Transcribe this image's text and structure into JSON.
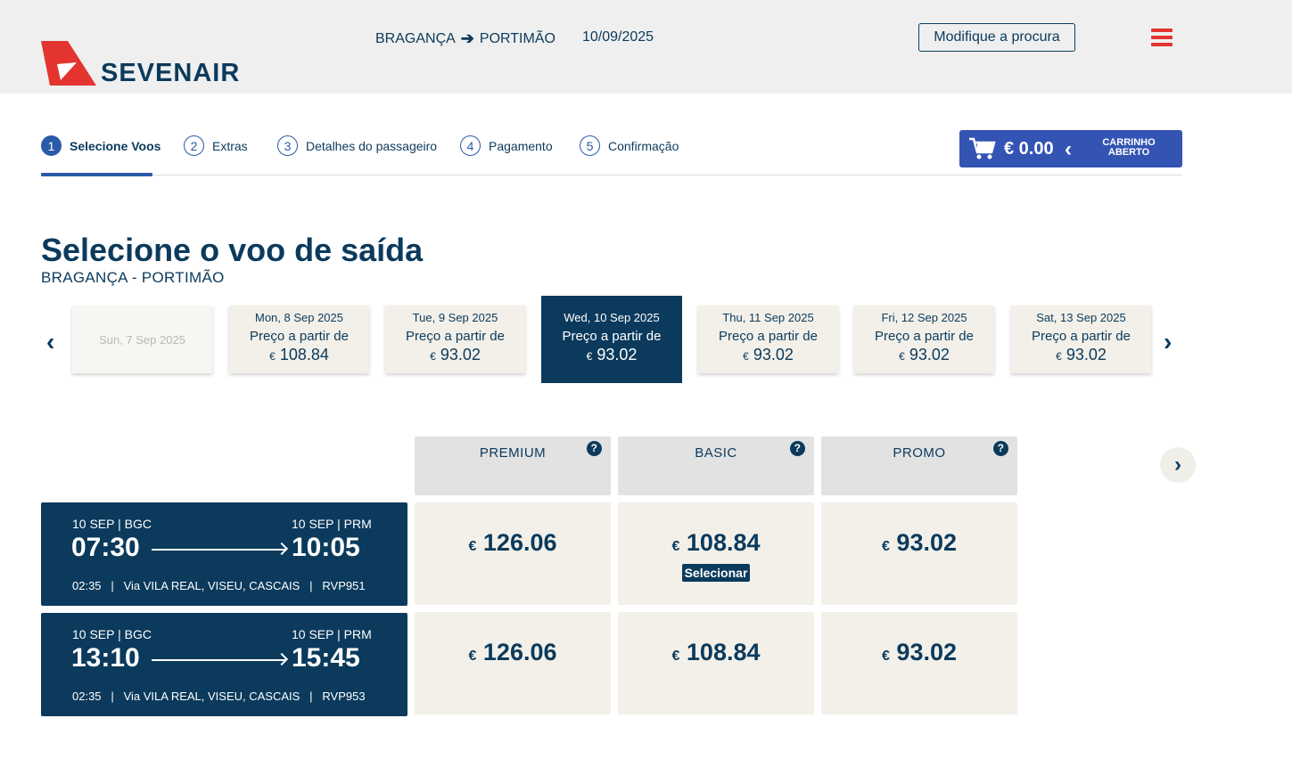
{
  "header": {
    "brand": "SEVENAIR",
    "origin": "BRAGANÇA",
    "arrow": "➔",
    "destination": "PORTIMÃO",
    "date": "10/09/2025",
    "modify_label": "Modifique a procura"
  },
  "steps": [
    {
      "num": "1",
      "label": "Selecione Voos",
      "active": true
    },
    {
      "num": "2",
      "label": "Extras"
    },
    {
      "num": "3",
      "label": "Detalhes do passageiro"
    },
    {
      "num": "4",
      "label": "Pagamento"
    },
    {
      "num": "5",
      "label": "Confirmação"
    }
  ],
  "cart": {
    "amount": "€ 0.00",
    "chevron": "‹",
    "label": "CARRINHO ABERTO"
  },
  "page": {
    "title": "Selecione o voo de saída",
    "subtitle": "BRAGANÇA - PORTIMÃO"
  },
  "dates": [
    {
      "date": "Sun, 7 Sep 2025",
      "disabled": true
    },
    {
      "date": "Mon, 8 Sep 2025",
      "from": "Preço a partir de",
      "cur": "€",
      "price": "108.84"
    },
    {
      "date": "Tue, 9 Sep 2025",
      "from": "Preço a partir de",
      "cur": "€",
      "price": "93.02"
    },
    {
      "date": "Wed, 10 Sep 2025",
      "from": "Preço a partir de",
      "cur": "€",
      "price": "93.02",
      "selected": true
    },
    {
      "date": "Thu, 11 Sep 2025",
      "from": "Preço a partir de",
      "cur": "€",
      "price": "93.02"
    },
    {
      "date": "Fri, 12 Sep 2025",
      "from": "Preço a partir de",
      "cur": "€",
      "price": "93.02"
    },
    {
      "date": "Sat, 13 Sep 2025",
      "from": "Preço a partir de",
      "cur": "€",
      "price": "93.02"
    }
  ],
  "carousel": {
    "prev": "‹",
    "next": "›"
  },
  "fares": [
    {
      "name": "PREMIUM",
      "help": "?"
    },
    {
      "name": "BASIC",
      "help": "?"
    },
    {
      "name": "PROMO",
      "help": "?"
    }
  ],
  "fares_next": "›",
  "flights": [
    {
      "dep_date": "10 SEP | BGC",
      "arr_date": "10 SEP | PRM",
      "dep_time": "07:30",
      "arr_time": "10:05",
      "info": "02:35   |   Via VILA REAL, VISEU, CASCAIS   |   RVP951",
      "prices": [
        {
          "cur": "€",
          "value": "126.06"
        },
        {
          "cur": "€",
          "value": "108.84",
          "select": "Selecionar"
        },
        {
          "cur": "€",
          "value": "93.02"
        }
      ]
    },
    {
      "dep_date": "10 SEP | BGC",
      "arr_date": "10 SEP | PRM",
      "dep_time": "13:10",
      "arr_time": "15:45",
      "info": "02:35   |   Via VILA REAL, VISEU, CASCAIS   |   RVP953",
      "prices": [
        {
          "cur": "€",
          "value": "126.06"
        },
        {
          "cur": "€",
          "value": "108.84"
        },
        {
          "cur": "€",
          "value": "93.02"
        }
      ]
    }
  ],
  "colors": {
    "navy": "#0b3a5c",
    "blue": "#2b5aa8",
    "cart": "#3454b4",
    "red": "#e3342f",
    "card": "#f2f0e9"
  }
}
